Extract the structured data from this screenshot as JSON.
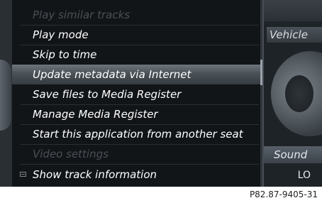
{
  "menu": {
    "items": [
      {
        "label": "Play similar tracks",
        "state": "disabled"
      },
      {
        "label": "Play mode",
        "state": "enabled"
      },
      {
        "label": "Skip to time",
        "state": "enabled"
      },
      {
        "label": "Update metadata via Internet",
        "state": "highlighted"
      },
      {
        "label": "Save files to Media Register",
        "state": "enabled"
      },
      {
        "label": "Manage Media Register",
        "state": "enabled"
      },
      {
        "label": "Start this application from another seat",
        "state": "enabled"
      },
      {
        "label": "Video settings",
        "state": "disabled"
      },
      {
        "label": "Show track information",
        "state": "enabled",
        "icon": "checkbox-icon"
      }
    ]
  },
  "background": {
    "vehicle_label": "Vehicle",
    "sound_label": "Sound",
    "lo_label": "LO"
  },
  "caption": "P82.87-9405-31"
}
